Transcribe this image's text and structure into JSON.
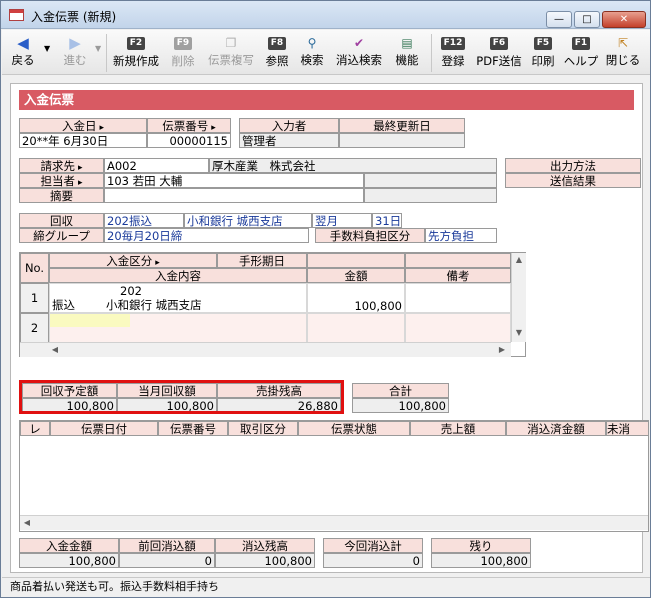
{
  "window": {
    "title": "入金伝票 (新規)",
    "minimize": "—",
    "maximize": "□",
    "close": "✕"
  },
  "toolbar": {
    "back": "戻る",
    "forward": "進む",
    "new": {
      "key": "F2",
      "label": "新規作成"
    },
    "delete": {
      "key": "F9",
      "label": "削除"
    },
    "copy": {
      "label": "伝票複写"
    },
    "ref": {
      "key": "F8",
      "label": "参照"
    },
    "search": {
      "label": "検索"
    },
    "clear_search": {
      "label": "消込検索"
    },
    "func": {
      "label": "機能"
    },
    "register": {
      "key": "F12",
      "label": "登録"
    },
    "pdf": {
      "key": "F6",
      "label": "PDF送信"
    },
    "print": {
      "key": "F5",
      "label": "印刷"
    },
    "help": {
      "key": "F1",
      "label": "ヘルプ"
    },
    "close": {
      "label": "閉じる"
    }
  },
  "header": "入金伝票",
  "slip": {
    "date_label": "入金日",
    "no_label": "伝票番号",
    "inputter_label": "入力者",
    "updated_label": "最終更新日",
    "date": "20**年 6月30日",
    "no": "00000115",
    "inputter": "管理者",
    "updated": ""
  },
  "customer": {
    "billing_label": "請求先",
    "billing_code": "A002",
    "billing_name": "厚木産業　株式会社",
    "staff_label": "担当者",
    "staff_code": "103",
    "staff_name": "若田 大輔",
    "summary_label": "摘要"
  },
  "side_buttons": {
    "output": "出力方法",
    "send": "送信結果"
  },
  "collect": {
    "label": "回収",
    "method_code": "202",
    "method": "振込",
    "bank": "小和銀行 城西支店",
    "month": "翌月",
    "day_code": "31",
    "day": "日",
    "group_label": "締グループ",
    "group_code": "20",
    "group": "毎月20日締",
    "fee_label": "手数料負担区分",
    "fee": "先方負担"
  },
  "detail": {
    "col_no": "No.",
    "col_kind": "入金区分",
    "col_note_date": "手形期日",
    "col_content": "入金内容",
    "col_amount": "金額",
    "col_remarks": "備考",
    "rows": [
      {
        "no": "1",
        "code": "202",
        "kind": "振込",
        "content": "小和銀行 城西支店",
        "amount": "100,800"
      },
      {
        "no": "2",
        "code": "",
        "kind": "",
        "content": "",
        "amount": ""
      }
    ]
  },
  "summary": {
    "planned_label": "回収予定額",
    "planned": "100,800",
    "month_label": "当月回収額",
    "month": "100,800",
    "balance_label": "売掛残高",
    "balance": "26,880",
    "total_label": "合計",
    "total": "100,800"
  },
  "list": {
    "cols": [
      "レ",
      "伝票日付",
      "伝票番号",
      "取引区分",
      "伝票状態",
      "売上額",
      "消込済金額",
      "未消"
    ]
  },
  "footer": {
    "deposit_label": "入金金額",
    "deposit": "100,800",
    "prev_label": "前回消込額",
    "prev": "0",
    "remain_label": "消込残高",
    "remain": "100,800",
    "current_label": "今回消込計",
    "current": "0",
    "rest_label": "残り",
    "rest": "100,800"
  },
  "status": "商品着払い発送も可。振込手数料相手持ち",
  "colors": {
    "header": "#d85a63",
    "label_bg": "#f8e0dc",
    "highlight": "#e01010"
  }
}
